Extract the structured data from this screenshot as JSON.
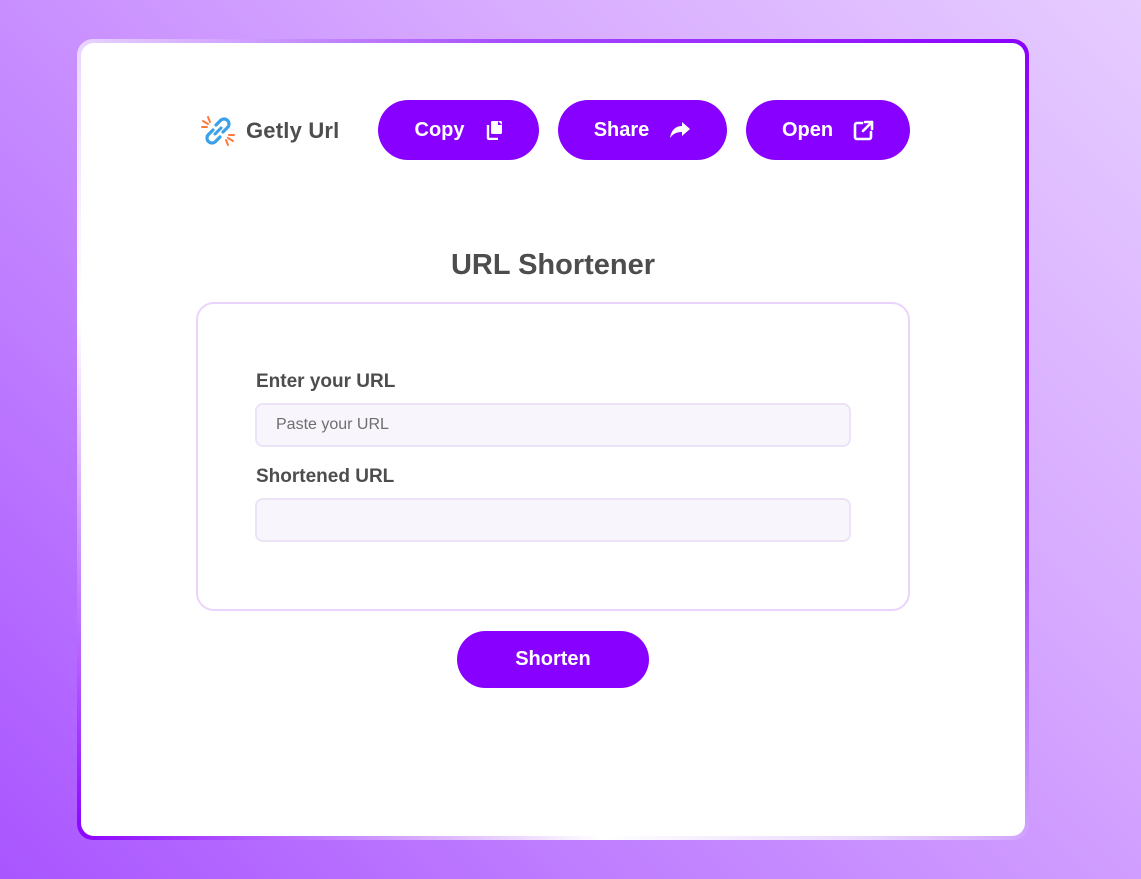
{
  "brand": {
    "name": "Getly Url",
    "icon": "link-icon"
  },
  "toolbar": {
    "copy_label": "Copy",
    "copy_icon": "copy-icon",
    "share_label": "Share",
    "share_icon": "share-icon",
    "open_label": "Open",
    "open_icon": "external-link-icon"
  },
  "main": {
    "title": "URL Shortener",
    "url_field": {
      "label": "Enter your URL",
      "placeholder": "Paste your URL",
      "value": ""
    },
    "short_field": {
      "label": "Shortened URL",
      "placeholder": "",
      "value": ""
    },
    "shorten_label": "Shorten"
  },
  "colors": {
    "accent": "#8800ff",
    "text": "#4d4d4d",
    "input_bg": "#f9f5fc",
    "box_border": "#ead4fb"
  }
}
